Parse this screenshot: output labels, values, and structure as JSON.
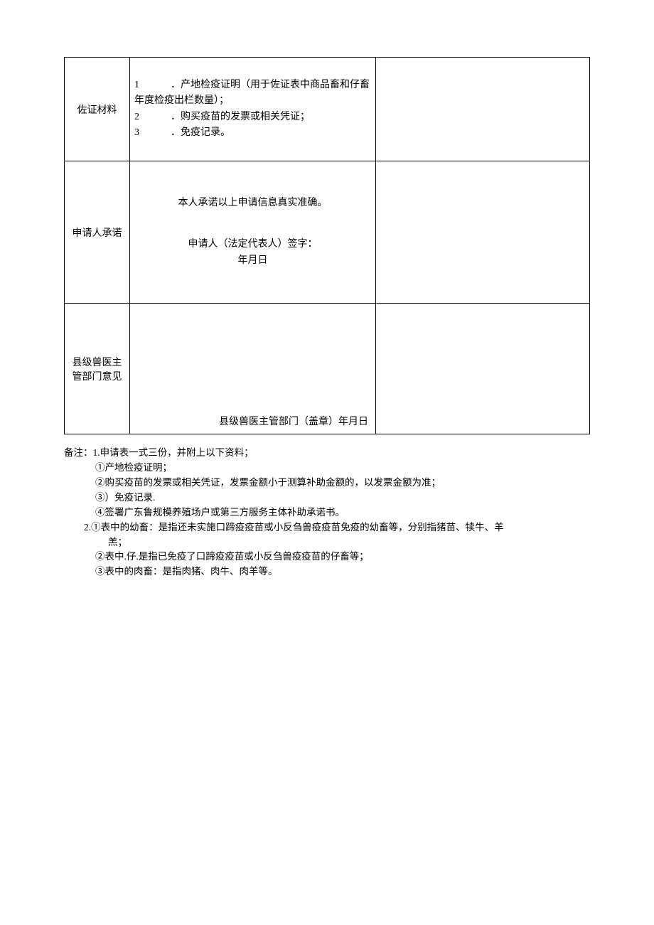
{
  "table": {
    "row1": {
      "label": "佐证材料",
      "item1_num": "1",
      "item1_text": "．产地检疫证明（用于佐证表中商品畜和仔畜年度检疫出栏数量）；",
      "item2_num": "2",
      "item2_text": "．购买疫苗的发票或相关凭证；",
      "item3_num": "3",
      "item3_text": "．免疫记录。"
    },
    "row2": {
      "label": "申请人承诺",
      "statement": "本人承诺以上申请信息真实准确。",
      "sign_label": "申请人（法定代表人）签字：",
      "date_label": "年月日"
    },
    "row3": {
      "label": "县级兽医主管部门意见",
      "seal_line": "县级兽医主管部门（盖章）年月日"
    }
  },
  "notes": {
    "line1": "备注：1.申请表一式三份，并附上以下资料；",
    "line2": "①产地检疫证明；",
    "line3": "②购买疫苗的发票或相关凭证，发票金额小于测算补助金额的，以发票金额为准；",
    "line4": "③）免疫记录.",
    "line5": "④签署广东鲁规模养殖场户或第三方服务主体补助承诺书。",
    "line6": "2.①表中的幼畜：是指还未实施口蹄疫疫苗或小反刍兽疫疫苗免疫的幼畜等，分别指猪苗、犊牛、羊",
    "line6b": "羔；",
    "line7": "②表中.仔.是指已免疫了口蹄疫疫苗或小反刍兽疫疫苗的仔畜等；",
    "line8": "③表中的肉畜：是指肉猪、肉牛、肉羊等。"
  }
}
